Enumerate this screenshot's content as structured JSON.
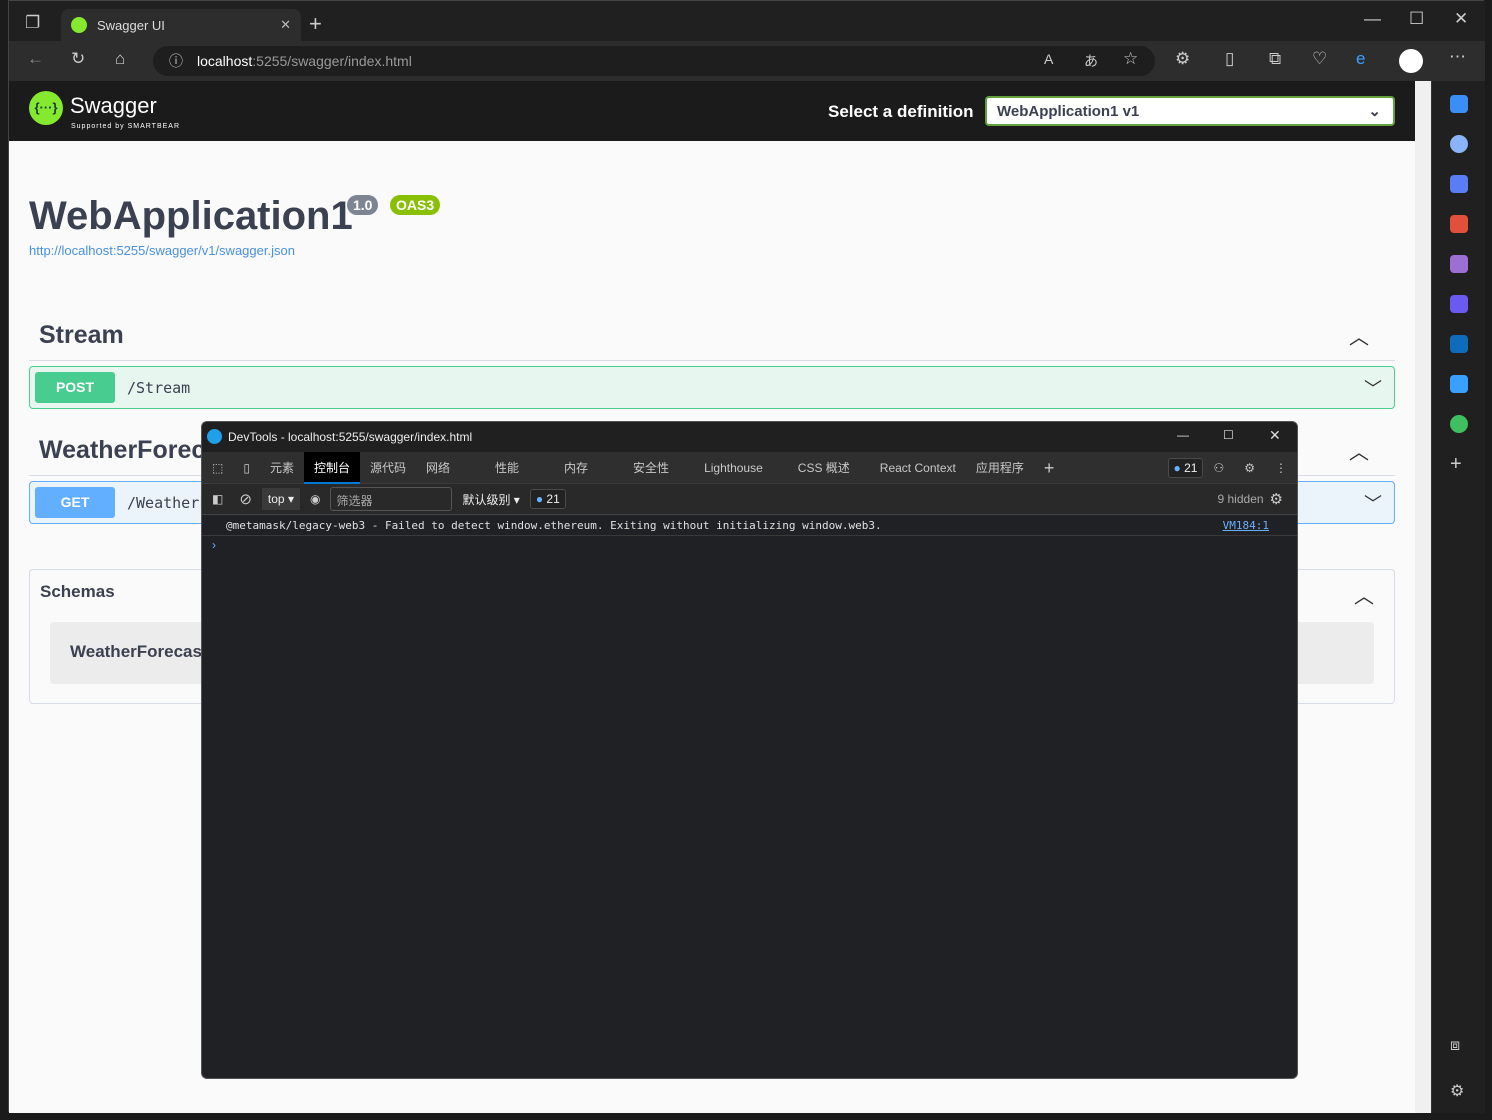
{
  "browser": {
    "tab_title": "Swagger UI",
    "url_host": "localhost",
    "url_rest": ":5255/swagger/index.html"
  },
  "swagger": {
    "logo_text": "Swagger",
    "logo_sub": "Supported by SMARTBEAR",
    "select_label": "Select a definition",
    "selected_definition": "WebApplication1 v1",
    "title": "WebApplication1",
    "version": "1.0",
    "oas": "OAS3",
    "spec_link": "http://localhost:5255/swagger/v1/swagger.json",
    "sections": [
      {
        "name": "Stream",
        "ops": [
          {
            "method": "POST",
            "path": "/Stream",
            "color": "#49cc90",
            "bg": "#e8f6f0"
          }
        ]
      },
      {
        "name": "WeatherForecast",
        "ops": [
          {
            "method": "GET",
            "path": "/WeatherForecast",
            "color": "#61affe",
            "bg": "#ebf3fb"
          }
        ]
      }
    ],
    "schemas_label": "Schemas",
    "schema_item": "WeatherForecast"
  },
  "devtools": {
    "title": "DevTools - localhost:5255/swagger/index.html",
    "tabs": [
      "元素",
      "控制台",
      "源代码",
      "网络",
      "性能",
      "内存",
      "安全性",
      "Lighthouse",
      "CSS 概述",
      "React Context",
      "应用程序"
    ],
    "active_tab": "控制台",
    "issues_count": "21",
    "context": "top",
    "filter_placeholder": "筛选器",
    "level": "默认级别",
    "msg_count": "21",
    "hidden": "9 hidden",
    "message": "@metamask/legacy-web3 - Failed to detect window.ethereum. Exiting without initializing window.web3.",
    "source": "VM184:1"
  }
}
